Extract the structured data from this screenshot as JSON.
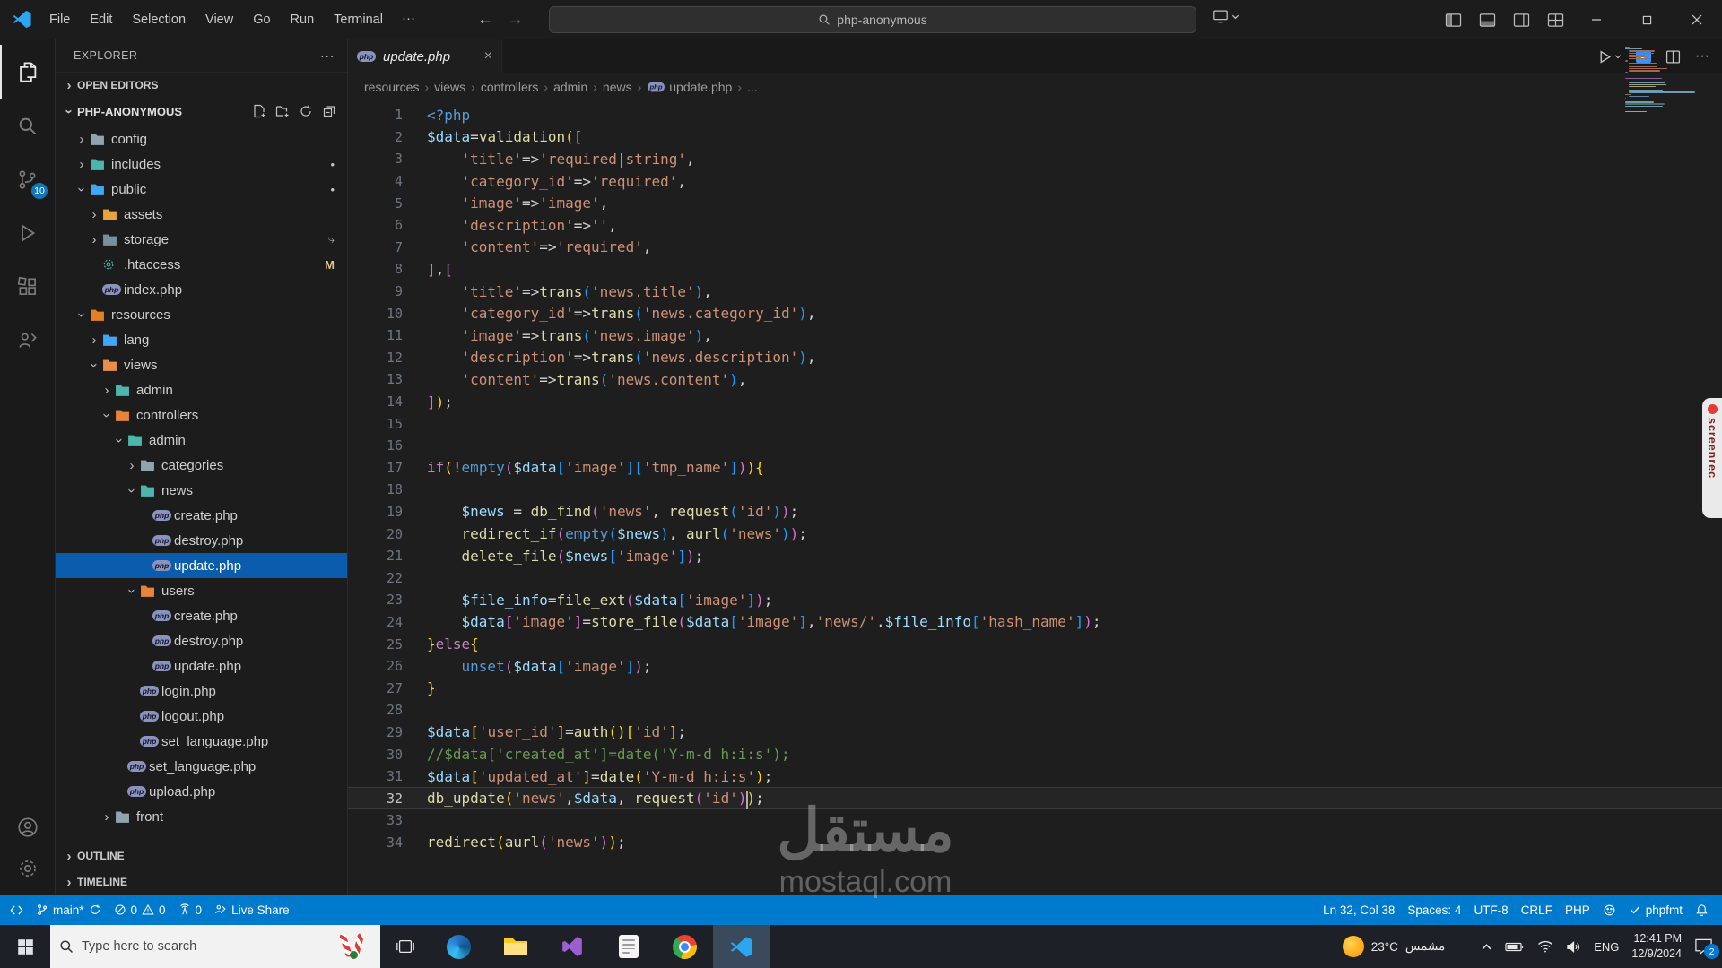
{
  "titlebar": {
    "menus": [
      "File",
      "Edit",
      "Selection",
      "View",
      "Go",
      "Run",
      "Terminal"
    ],
    "more": "···",
    "search_value": "php-anonymous"
  },
  "activitybar": {
    "scm_badge": "10"
  },
  "sidebar": {
    "title": "EXPLORER",
    "open_editors": "OPEN EDITORS",
    "project": "PHP-ANONYMOUS",
    "outline": "OUTLINE",
    "timeline": "TIMELINE",
    "tree": [
      {
        "label": "config",
        "lvl": 0,
        "chev": "r",
        "color": "#90a4ae"
      },
      {
        "label": "includes",
        "lvl": 0,
        "chev": "r",
        "color": "#4db6ac",
        "badge": "dot"
      },
      {
        "label": "public",
        "lvl": 0,
        "chev": "d",
        "color": "#42a5f5",
        "badge": "dot"
      },
      {
        "label": "assets",
        "lvl": 1,
        "chev": "r",
        "color": "#e8a33d"
      },
      {
        "label": "storage",
        "lvl": 1,
        "chev": "r",
        "color": "#78909c",
        "badge": "arrow"
      },
      {
        "label": ".htaccess",
        "lvl": 1,
        "kind": "gear",
        "badge": "M"
      },
      {
        "label": "index.php",
        "lvl": 1,
        "kind": "php"
      },
      {
        "label": "resources",
        "lvl": 0,
        "chev": "d",
        "color": "#e67e22"
      },
      {
        "label": "lang",
        "lvl": 1,
        "chev": "r",
        "color": "#42a5f5"
      },
      {
        "label": "views",
        "lvl": 1,
        "chev": "d",
        "color": "#e98f4e"
      },
      {
        "label": "admin",
        "lvl": 2,
        "chev": "r",
        "color": "#4db6ac"
      },
      {
        "label": "controllers",
        "lvl": 2,
        "chev": "d",
        "color": "#e8833a"
      },
      {
        "label": "admin",
        "lvl": 3,
        "chev": "d",
        "color": "#4db6ac"
      },
      {
        "label": "categories",
        "lvl": 4,
        "chev": "r",
        "color": "#90a4ae"
      },
      {
        "label": "news",
        "lvl": 4,
        "chev": "d",
        "color": "#4db6ac"
      },
      {
        "label": "create.php",
        "lvl": 5,
        "kind": "php"
      },
      {
        "label": "destroy.php",
        "lvl": 5,
        "kind": "php"
      },
      {
        "label": "update.php",
        "lvl": 5,
        "kind": "php",
        "selected": true
      },
      {
        "label": "users",
        "lvl": 4,
        "chev": "d",
        "color": "#e8833a"
      },
      {
        "label": "create.php",
        "lvl": 5,
        "kind": "php"
      },
      {
        "label": "destroy.php",
        "lvl": 5,
        "kind": "php"
      },
      {
        "label": "update.php",
        "lvl": 5,
        "kind": "php"
      },
      {
        "label": "login.php",
        "lvl": 4,
        "kind": "php"
      },
      {
        "label": "logout.php",
        "lvl": 4,
        "kind": "php"
      },
      {
        "label": "set_language.php",
        "lvl": 4,
        "kind": "php"
      },
      {
        "label": "set_language.php",
        "lvl": 3,
        "kind": "php"
      },
      {
        "label": "upload.php",
        "lvl": 3,
        "kind": "php"
      },
      {
        "label": "front",
        "lvl": 2,
        "chev": "r",
        "color": "#90a4ae"
      }
    ]
  },
  "editor": {
    "tab": "update.php",
    "breadcrumbs": [
      "resources",
      "views",
      "controllers",
      "admin",
      "news",
      "update.php",
      "..."
    ],
    "cursor": {
      "line": 32,
      "col": 38
    },
    "lines": [
      {
        "n": 1,
        "t": [
          [
            "b",
            "<?php"
          ]
        ]
      },
      {
        "n": 2,
        "t": [
          [
            "v",
            "$data"
          ],
          [
            "p",
            "="
          ],
          [
            "f",
            "validation"
          ],
          [
            "g",
            "("
          ],
          [
            "m",
            "["
          ]
        ]
      },
      {
        "n": 3,
        "t": [
          [
            "p",
            "    "
          ],
          [
            "s",
            "'title'"
          ],
          [
            "p",
            "=>"
          ],
          [
            "s",
            "'required|string'"
          ],
          [
            "p",
            ","
          ]
        ]
      },
      {
        "n": 4,
        "t": [
          [
            "p",
            "    "
          ],
          [
            "s",
            "'category_id'"
          ],
          [
            "p",
            "=>"
          ],
          [
            "s",
            "'required'"
          ],
          [
            "p",
            ","
          ]
        ]
      },
      {
        "n": 5,
        "t": [
          [
            "p",
            "    "
          ],
          [
            "s",
            "'image'"
          ],
          [
            "p",
            "=>"
          ],
          [
            "s",
            "'image'"
          ],
          [
            "p",
            ","
          ]
        ]
      },
      {
        "n": 6,
        "t": [
          [
            "p",
            "    "
          ],
          [
            "s",
            "'description'"
          ],
          [
            "p",
            "=>"
          ],
          [
            "s",
            "''"
          ],
          [
            "p",
            ","
          ]
        ]
      },
      {
        "n": 7,
        "t": [
          [
            "p",
            "    "
          ],
          [
            "s",
            "'content'"
          ],
          [
            "p",
            "=>"
          ],
          [
            "s",
            "'required'"
          ],
          [
            "p",
            ","
          ]
        ]
      },
      {
        "n": 8,
        "t": [
          [
            "m",
            "]"
          ],
          [
            "p",
            ","
          ],
          [
            "m",
            "["
          ]
        ]
      },
      {
        "n": 9,
        "t": [
          [
            "p",
            "    "
          ],
          [
            "s",
            "'title'"
          ],
          [
            "p",
            "=>"
          ],
          [
            "f",
            "trans"
          ],
          [
            "u",
            "("
          ],
          [
            "s",
            "'news.title'"
          ],
          [
            "u",
            ")"
          ],
          [
            "p",
            ","
          ]
        ]
      },
      {
        "n": 10,
        "t": [
          [
            "p",
            "    "
          ],
          [
            "s",
            "'category_id'"
          ],
          [
            "p",
            "=>"
          ],
          [
            "f",
            "trans"
          ],
          [
            "u",
            "("
          ],
          [
            "s",
            "'news.category_id'"
          ],
          [
            "u",
            ")"
          ],
          [
            "p",
            ","
          ]
        ]
      },
      {
        "n": 11,
        "t": [
          [
            "p",
            "    "
          ],
          [
            "s",
            "'image'"
          ],
          [
            "p",
            "=>"
          ],
          [
            "f",
            "trans"
          ],
          [
            "u",
            "("
          ],
          [
            "s",
            "'news.image'"
          ],
          [
            "u",
            ")"
          ],
          [
            "p",
            ","
          ]
        ]
      },
      {
        "n": 12,
        "t": [
          [
            "p",
            "    "
          ],
          [
            "s",
            "'description'"
          ],
          [
            "p",
            "=>"
          ],
          [
            "f",
            "trans"
          ],
          [
            "u",
            "("
          ],
          [
            "s",
            "'news.description'"
          ],
          [
            "u",
            ")"
          ],
          [
            "p",
            ","
          ]
        ]
      },
      {
        "n": 13,
        "t": [
          [
            "p",
            "    "
          ],
          [
            "s",
            "'content'"
          ],
          [
            "p",
            "=>"
          ],
          [
            "f",
            "trans"
          ],
          [
            "u",
            "("
          ],
          [
            "s",
            "'news.content'"
          ],
          [
            "u",
            ")"
          ],
          [
            "p",
            ","
          ]
        ]
      },
      {
        "n": 14,
        "t": [
          [
            "m",
            "]"
          ],
          [
            "g",
            ")"
          ],
          [
            "p",
            ";"
          ]
        ]
      },
      {
        "n": 15,
        "t": []
      },
      {
        "n": 16,
        "t": []
      },
      {
        "n": 17,
        "t": [
          [
            "k",
            "if"
          ],
          [
            "g",
            "("
          ],
          [
            "p",
            "!"
          ],
          [
            "b",
            "empty"
          ],
          [
            "m",
            "("
          ],
          [
            "v",
            "$data"
          ],
          [
            "u",
            "["
          ],
          [
            "s",
            "'image'"
          ],
          [
            "u",
            "]"
          ],
          [
            "u",
            "["
          ],
          [
            "s",
            "'tmp_name'"
          ],
          [
            "u",
            "]"
          ],
          [
            "m",
            ")"
          ],
          [
            "g",
            ")"
          ],
          [
            "g",
            "{"
          ]
        ]
      },
      {
        "n": 18,
        "t": []
      },
      {
        "n": 19,
        "t": [
          [
            "p",
            "    "
          ],
          [
            "v",
            "$news"
          ],
          [
            "p",
            " = "
          ],
          [
            "f",
            "db_find"
          ],
          [
            "m",
            "("
          ],
          [
            "s",
            "'news'"
          ],
          [
            "p",
            ", "
          ],
          [
            "f",
            "request"
          ],
          [
            "u",
            "("
          ],
          [
            "s",
            "'id'"
          ],
          [
            "u",
            ")"
          ],
          [
            "m",
            ")"
          ],
          [
            "p",
            ";"
          ]
        ]
      },
      {
        "n": 20,
        "t": [
          [
            "p",
            "    "
          ],
          [
            "f",
            "redirect_if"
          ],
          [
            "m",
            "("
          ],
          [
            "b",
            "empty"
          ],
          [
            "u",
            "("
          ],
          [
            "v",
            "$news"
          ],
          [
            "u",
            ")"
          ],
          [
            "p",
            ", "
          ],
          [
            "f",
            "aurl"
          ],
          [
            "u",
            "("
          ],
          [
            "s",
            "'news'"
          ],
          [
            "u",
            ")"
          ],
          [
            "m",
            ")"
          ],
          [
            "p",
            ";"
          ]
        ]
      },
      {
        "n": 21,
        "t": [
          [
            "p",
            "    "
          ],
          [
            "f",
            "delete_file"
          ],
          [
            "m",
            "("
          ],
          [
            "v",
            "$news"
          ],
          [
            "u",
            "["
          ],
          [
            "s",
            "'image'"
          ],
          [
            "u",
            "]"
          ],
          [
            "m",
            ")"
          ],
          [
            "p",
            ";"
          ]
        ]
      },
      {
        "n": 22,
        "t": []
      },
      {
        "n": 23,
        "t": [
          [
            "p",
            "    "
          ],
          [
            "v",
            "$file_info"
          ],
          [
            "p",
            "="
          ],
          [
            "f",
            "file_ext"
          ],
          [
            "m",
            "("
          ],
          [
            "v",
            "$data"
          ],
          [
            "u",
            "["
          ],
          [
            "s",
            "'image'"
          ],
          [
            "u",
            "]"
          ],
          [
            "m",
            ")"
          ],
          [
            "p",
            ";"
          ]
        ]
      },
      {
        "n": 24,
        "t": [
          [
            "p",
            "    "
          ],
          [
            "v",
            "$data"
          ],
          [
            "m",
            "["
          ],
          [
            "s",
            "'image'"
          ],
          [
            "m",
            "]"
          ],
          [
            "p",
            "="
          ],
          [
            "f",
            "store_file"
          ],
          [
            "m",
            "("
          ],
          [
            "v",
            "$data"
          ],
          [
            "u",
            "["
          ],
          [
            "s",
            "'image'"
          ],
          [
            "u",
            "]"
          ],
          [
            "p",
            ","
          ],
          [
            "s",
            "'news/'"
          ],
          [
            "p",
            "."
          ],
          [
            "v",
            "$file_info"
          ],
          [
            "u",
            "["
          ],
          [
            "s",
            "'hash_name'"
          ],
          [
            "u",
            "]"
          ],
          [
            "m",
            ")"
          ],
          [
            "p",
            ";"
          ]
        ]
      },
      {
        "n": 25,
        "t": [
          [
            "g",
            "}"
          ],
          [
            "k",
            "else"
          ],
          [
            "g",
            "{"
          ]
        ]
      },
      {
        "n": 26,
        "t": [
          [
            "p",
            "    "
          ],
          [
            "b",
            "unset"
          ],
          [
            "m",
            "("
          ],
          [
            "v",
            "$data"
          ],
          [
            "u",
            "["
          ],
          [
            "s",
            "'image'"
          ],
          [
            "u",
            "]"
          ],
          [
            "m",
            ")"
          ],
          [
            "p",
            ";"
          ]
        ]
      },
      {
        "n": 27,
        "t": [
          [
            "g",
            "}"
          ]
        ]
      },
      {
        "n": 28,
        "t": []
      },
      {
        "n": 29,
        "t": [
          [
            "v",
            "$data"
          ],
          [
            "g",
            "["
          ],
          [
            "s",
            "'user_id'"
          ],
          [
            "g",
            "]"
          ],
          [
            "p",
            "="
          ],
          [
            "f",
            "auth"
          ],
          [
            "g",
            "()"
          ],
          [
            "g",
            "["
          ],
          [
            "s",
            "'id'"
          ],
          [
            "g",
            "]"
          ],
          [
            "p",
            ";"
          ]
        ]
      },
      {
        "n": 30,
        "t": [
          [
            "c",
            "//$data['created_at']=date('Y-m-d h:i:s');"
          ]
        ]
      },
      {
        "n": 31,
        "t": [
          [
            "v",
            "$data"
          ],
          [
            "g",
            "["
          ],
          [
            "s",
            "'updated_at'"
          ],
          [
            "g",
            "]"
          ],
          [
            "p",
            "="
          ],
          [
            "f",
            "date"
          ],
          [
            "g",
            "("
          ],
          [
            "s",
            "'Y-m-d h:i:s'"
          ],
          [
            "g",
            ")"
          ],
          [
            "p",
            ";"
          ]
        ]
      },
      {
        "n": 32,
        "t": [
          [
            "f",
            "db_update"
          ],
          [
            "g",
            "("
          ],
          [
            "s",
            "'news'"
          ],
          [
            "p",
            ","
          ],
          [
            "v",
            "$data"
          ],
          [
            "p",
            ", "
          ],
          [
            "f",
            "request"
          ],
          [
            "m",
            "("
          ],
          [
            "s",
            "'id'"
          ],
          [
            "m",
            ")"
          ],
          [
            "g",
            ")"
          ],
          [
            "p",
            ";"
          ]
        ]
      },
      {
        "n": 33,
        "t": []
      },
      {
        "n": 34,
        "t": [
          [
            "f",
            "redirect"
          ],
          [
            "g",
            "("
          ],
          [
            "f",
            "aurl"
          ],
          [
            "m",
            "("
          ],
          [
            "s",
            "'news'"
          ],
          [
            "m",
            ")"
          ],
          [
            "g",
            ")"
          ],
          [
            "p",
            ";"
          ]
        ]
      }
    ]
  },
  "statusbar": {
    "branch": "main*",
    "errors": "0",
    "warnings": "0",
    "ports": "0",
    "liveshare": "Live Share",
    "cursor_position": "Ln 32, Col 38",
    "indentation": "Spaces: 4",
    "encoding": "UTF-8",
    "eol": "CRLF",
    "language": "PHP",
    "formatter": "phpfmt"
  },
  "taskbar": {
    "search_placeholder": "Type here to search",
    "weather_temp": "23°C",
    "weather_desc": "مشمس",
    "language": "ENG",
    "time": "12:41 PM",
    "date": "12/9/2024",
    "notifications": "2"
  },
  "overlay": {
    "watermark_ar": "مستقل",
    "watermark_en": "mostaql.com",
    "screenrec": "screenrec"
  }
}
